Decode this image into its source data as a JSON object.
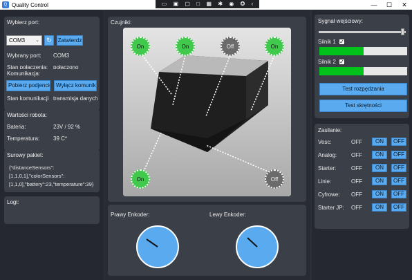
{
  "window": {
    "title": "Quality Control"
  },
  "overlay_icons": [
    "screen-icon",
    "camera-icon",
    "monitor-icon",
    "window-icon",
    "grid-icon",
    "bug-icon",
    "steam-icon",
    "accessibility-icon",
    "close-overlay-icon"
  ],
  "port": {
    "title": "Wybierz port:",
    "selected": "COM3",
    "confirm_label": "Zatwierdz",
    "selected_label": "Wybrany port:",
    "selected_value": "COM3",
    "state_label": "Stan połączenia:",
    "state_value": "połączono"
  },
  "communication": {
    "title": "Komunikacja:",
    "fetch_label": "Pobierz podjencie",
    "disable_label": "Wyłącz komunikacje",
    "state_label": "Stan komunikacji",
    "state_value": "transmisja danych"
  },
  "robot": {
    "title": "Wartości robota:",
    "battery_label": "Bateria:",
    "battery_value": "23V / 92 %",
    "temperature_label": "Temperatura:",
    "temperature_value": "39 C*"
  },
  "raw_packet": {
    "title": "Surowy pakiet:",
    "lines": [
      "{\"distanceSensors\":",
      "[1,1,0,1],\"colorSensors\":",
      "[1,1,0],\"battery\":23,\"temperature\":39}"
    ]
  },
  "logs": {
    "title": "Logi:"
  },
  "sensors": {
    "title": "Czujniki:",
    "items": [
      {
        "name": "sensor-top-1",
        "state": "On"
      },
      {
        "name": "sensor-top-2",
        "state": "On"
      },
      {
        "name": "sensor-top-3",
        "state": "Off"
      },
      {
        "name": "sensor-top-4",
        "state": "On"
      },
      {
        "name": "sensor-bottom-left",
        "state": "On"
      },
      {
        "name": "sensor-bottom-right",
        "state": "Off"
      }
    ]
  },
  "encoders": {
    "right_label": "Prawy Enkoder:",
    "left_label": "Lewy Enkoder:"
  },
  "input_signal": {
    "title": "Sygnał wejściowy:",
    "slider_level": 0.97,
    "motor1_label": "Silnik 1",
    "motor1_checked": true,
    "motor1_level": 0.5,
    "motor2_label": "Silnik 2",
    "motor2_checked": true,
    "motor2_level": 0.5,
    "test_accel_label": "Test rozpędzania",
    "test_turn_label": "Test skrętności"
  },
  "power": {
    "title": "Zasilanie:",
    "rows": [
      {
        "label": "Vesc:",
        "state": "OFF",
        "on": "ON",
        "off": "OFF"
      },
      {
        "label": "Analog:",
        "state": "OFF",
        "on": "ON",
        "off": "OFF"
      },
      {
        "label": "Starter:",
        "state": "OFF",
        "on": "ON",
        "off": "OFF"
      },
      {
        "label": "Linie:",
        "state": "OFF",
        "on": "ON",
        "off": "OFF"
      },
      {
        "label": "Cyfrowe:",
        "state": "OFF",
        "on": "ON",
        "off": "OFF"
      },
      {
        "label": "Starter JP:",
        "state": "OFF",
        "on": "ON",
        "off": "OFF"
      }
    ]
  },
  "colors": {
    "accent": "#5aaaf0",
    "on": "#41c94d",
    "off": "#6b6b6b",
    "bar": "#00c21b"
  }
}
